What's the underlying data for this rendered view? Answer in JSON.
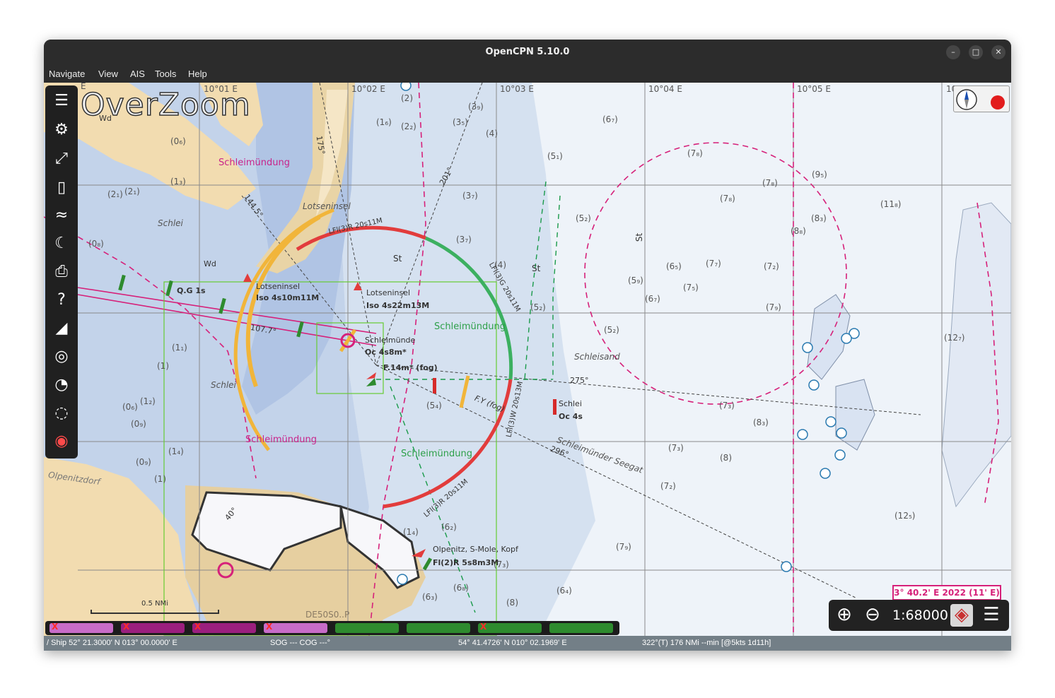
{
  "window": {
    "title": "OpenCPN 5.10.0",
    "controls": [
      "–",
      "□",
      "✕"
    ]
  },
  "menu": [
    "Navigate",
    "View",
    "AIS",
    "Tools",
    "Help"
  ],
  "chart": {
    "overlay_text": "OverZoom",
    "longitude_ticks": [
      "E",
      "10°01 E",
      "10°02 E",
      "10°03 E",
      "10°04 E",
      "10°05 E",
      "10"
    ],
    "place_names": [
      "Schleimündung",
      "Lotseninsel",
      "Schlei",
      "Schleimündung",
      "Schlei",
      "Schleimündung",
      "Schleimündung",
      "Schleisand",
      "Olpenitzdorf",
      "Schleimünder Seegat",
      "Schlei"
    ],
    "light_labels": [
      "Q.G 1s",
      "Lotseninsel",
      "Iso 4s10m11M",
      "Lotseninsel",
      "Iso 4s22m13M",
      "Schleimünde",
      "Oc 4s8m*",
      "F.14m* (fog)",
      "Oc 4s",
      "LFl(3)R 20s11M",
      "LFl(3)G 20s11M",
      "LFl(3)W 20s13M",
      "LFl(3)R 20s11M",
      "F.Y (fog)",
      "Olpenitz, S-Mole, Kopf",
      "Fl(2)R 5s8m3M"
    ],
    "bearings": [
      "275°",
      "296°",
      "107.7°",
      "144.5°",
      "175°",
      "201°",
      "40°"
    ],
    "chart_code": "DE50S0..P",
    "misc_labels": [
      "St",
      "St",
      "St",
      "Wd",
      "Wd"
    ],
    "soundings": [
      "(2)",
      "(1₆)",
      "(2₂)",
      "(3₉)",
      "(3₅)",
      "(4)",
      "(6₇)",
      "(7₈)",
      "(5₁)",
      "(3₇)",
      "(3₇)",
      "(4)",
      "(5₂)",
      "(5₂)",
      "(5₂)",
      "(6₅)",
      "(7₇)",
      "(7₂)",
      "(5₉)",
      "(7₅)",
      "(6₇)",
      "(7₉)",
      "(7₈)",
      "(7₈)",
      "(11₈)",
      "(9₅)",
      "(8₃)",
      "(8₈)",
      "(12₇)",
      "(7₃)",
      "(8₃)",
      "(7₃)",
      "(8)",
      "(7₂)",
      "(7₉)",
      "(12₅)",
      "(6₄)",
      "(6₈)",
      "(6₃)",
      "(8)",
      "(5₄)",
      "(0₆)",
      "(1₃)",
      "(2₁)",
      "(2₁)",
      "(0₈)",
      "(1₁)",
      "(1)",
      "(0₆)",
      "(1₂)",
      "(0₉)",
      "(1₄)",
      "(0₉)",
      "(1)",
      "(1₄)",
      "(6₂)",
      "(7₃)"
    ],
    "scale_bar_label": "0.5 NMi",
    "magnetic_variation": "3° 40.2' E 2022 (11' E)"
  },
  "toolbar": {
    "tools": [
      "menu-icon",
      "settings-icon",
      "route-icon",
      "waypoint-list-icon",
      "track-icon",
      "night-mode-icon",
      "print-icon",
      "help-icon",
      "tide-icon",
      "ais-target-icon",
      "dashboard-icon",
      "currents-icon",
      "mob-icon"
    ]
  },
  "zoom_controls": {
    "scale": "1:68000",
    "zoom_in": "zoom-in-icon",
    "zoom_out": "zoom-out-icon",
    "chart_menu": "hamburger-icon"
  },
  "piano": {
    "keys": [
      {
        "color": "#c86cc8",
        "x": true
      },
      {
        "color": "#9b1f7e",
        "x": true
      },
      {
        "color": "#9b1f7e",
        "x": true
      },
      {
        "color": "#c86cc8",
        "x": true
      },
      {
        "color": "#2e8b2e",
        "x": false
      },
      {
        "color": "#2e8b2e",
        "x": false
      },
      {
        "color": "#2e8b2e",
        "x": true
      },
      {
        "color": "#2e8b2e",
        "x": false
      }
    ],
    "x_mark": "X"
  },
  "status": {
    "ship": "/ Ship 52° 21.3000' N  013° 00.0000' E",
    "sog_cog": "SOG --- COG ---°",
    "cursor": "54° 41.4726' N   010° 02.1969' E",
    "bearing": "322°(T)  176 NMi --min [@5kts 1d11h]"
  }
}
